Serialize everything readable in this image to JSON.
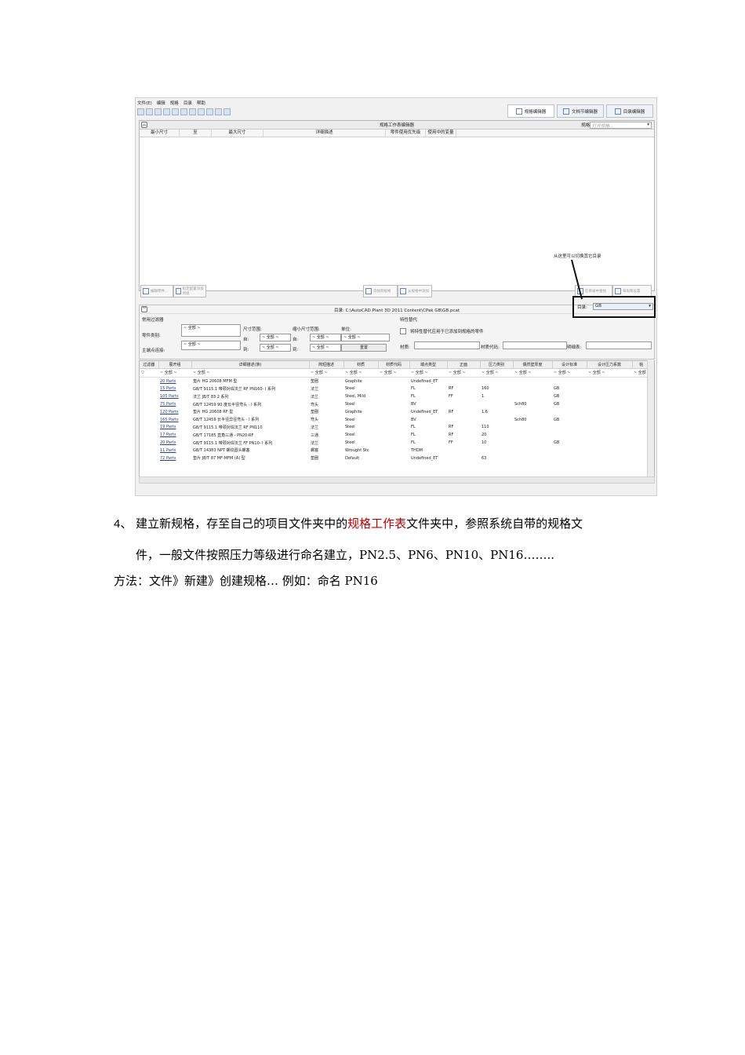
{
  "screenshot": {
    "menu": [
      "文件(E)",
      "编辑",
      "规格",
      "目录",
      "帮助"
    ],
    "tabs": [
      {
        "label": "规格编辑器",
        "icon": "spec-editor-icon"
      },
      {
        "label": "文档节编辑器",
        "icon": "doc-editor-icon"
      },
      {
        "label": "目录编辑器",
        "icon": "catalog-editor-icon"
      }
    ],
    "spec_panel": {
      "title": "规格工作表编辑器",
      "spec_label": "规格:",
      "spec_placeholder": "打开规格...",
      "columns": [
        "最小尺寸",
        "至",
        "最大尺寸",
        "详细描述",
        "零件使用优先级",
        "使用中的变量"
      ],
      "buttons": {
        "edit_part": "编辑零件...",
        "add_to_spec": "指定配置添加到组",
        "add_group": "添加到规格",
        "from_catalog": "从规格中添加",
        "find_in_catalog": "在目录中查找",
        "catalog_settings": "布局和设置"
      }
    },
    "annotation": "从这里可以切换其它目录",
    "catalog": {
      "path_label": "目录: C:\\AutoCAD Plant 3D 2011 Content\\CPak GB\\GB.pcat",
      "catalog_label": "目录:",
      "catalog_value": "GB"
    },
    "filters": {
      "common_title": "常用过滤器",
      "part_category_label": "零件类别:",
      "part_category_value": "~ 全部 ~",
      "end_connection_label": "主端点连接:",
      "end_connection_value": "~ 全部 ~",
      "size_range_label": "尺寸范围:",
      "from_label": "自:",
      "to_label": "到:",
      "small_size_label": "缩小尺寸范围:",
      "unit_label": "单位:",
      "all": "~ 全部 ~",
      "reset_button": "重置",
      "property_title": "特性替代",
      "property_checkbox": "将特性替代应用于已添加到规格的零件",
      "material_label": "材质:",
      "material_code_label": "材质代码:",
      "schedule_label": "明细表:"
    },
    "grid": {
      "headers": [
        "过滤器",
        "展开组",
        "详细描述(族)",
        "简短描述",
        "材质",
        "材质代码",
        "端点类型",
        "正面",
        "压力类别",
        "偶然壁厚度",
        "设计标准",
        "设计压力系数",
        "帕"
      ],
      "filter_value": "~ 全部 ~",
      "rows": [
        [
          "20 Parts",
          "垫片 HG 20608 MFM 型",
          "垫圈",
          "Graphite",
          "",
          "Undefined_ET",
          "",
          "",
          "",
          "",
          ""
        ],
        [
          "15 Parts",
          "GB/T 9115.1 带颈对焊法兰  RF PN160- I 系列",
          "法兰",
          "Steel",
          "",
          "FL",
          "RF",
          "160",
          "",
          "GB",
          ""
        ],
        [
          "105 Parts",
          "法兰 JB/T 83 2 系列",
          "法兰",
          "Steel, Mild",
          "",
          "FL",
          "FF",
          "1",
          "",
          "GB",
          ""
        ],
        [
          "75 Parts",
          "GB/T 12459 90 度长半径弯头 - I 系列",
          "弯头",
          "Steel",
          "",
          "BV",
          "",
          "",
          "Sch80",
          "GB",
          ""
        ],
        [
          "120 Parts",
          "垫片 HG 20608 RF 型",
          "垫圈",
          "Graphite",
          "",
          "Undefined_ET",
          "RF",
          "1.6",
          "",
          "",
          ""
        ],
        [
          "165 Parts",
          "GB/T 12459 长半径异径弯头 - I 系列",
          "弯头",
          "Steel",
          "",
          "BV",
          "",
          "",
          "Sch80",
          "GB",
          ""
        ],
        [
          "19 Parts",
          "GB/T 9115.1 带颈对焊法兰  RF PN110",
          "法兰",
          "Steel",
          "",
          "FL",
          "RF",
          "110",
          "",
          "",
          ""
        ],
        [
          "17 Parts",
          "GB/T 17185 直角三通 - PN20-RF",
          "三通",
          "Steel",
          "",
          "FL",
          "RF",
          "20",
          "",
          "",
          ""
        ],
        [
          "20 Parts",
          "GB/T 9115.1 带颈对焊法兰  FF PN10- I 系列",
          "法兰",
          "Steel",
          "",
          "FL",
          "FF",
          "10",
          "",
          "GB",
          ""
        ],
        [
          "11 Parts",
          "GB/T 14383 NPT 螺纹圆头螺塞",
          "螺塞",
          "Wrought Stc",
          "",
          "THDM",
          "",
          "",
          "",
          "",
          ""
        ],
        [
          "72 Parts",
          "垫片 JB/T 87 MF-MFM (A) 型",
          "垫圈",
          "Default",
          "",
          "Undefined_ET",
          "",
          "63",
          "",
          "",
          ""
        ]
      ]
    }
  },
  "text": {
    "step_num": "4、",
    "step_a": "建立新规格，存至自己的项目文件夹中的",
    "step_red": "规格工作表",
    "step_b": "文件夹中，参照系统自带的规格文",
    "line2": "件，一般文件按照压力等级进行命名建立，PN2.5、PN6、PN10、PN16……..",
    "line3": "方法：文件》新建》创建规格…   例如：命名 PN16"
  },
  "colors": {
    "highlight_red": "#c00000",
    "link_blue": "#2a3f8e"
  }
}
